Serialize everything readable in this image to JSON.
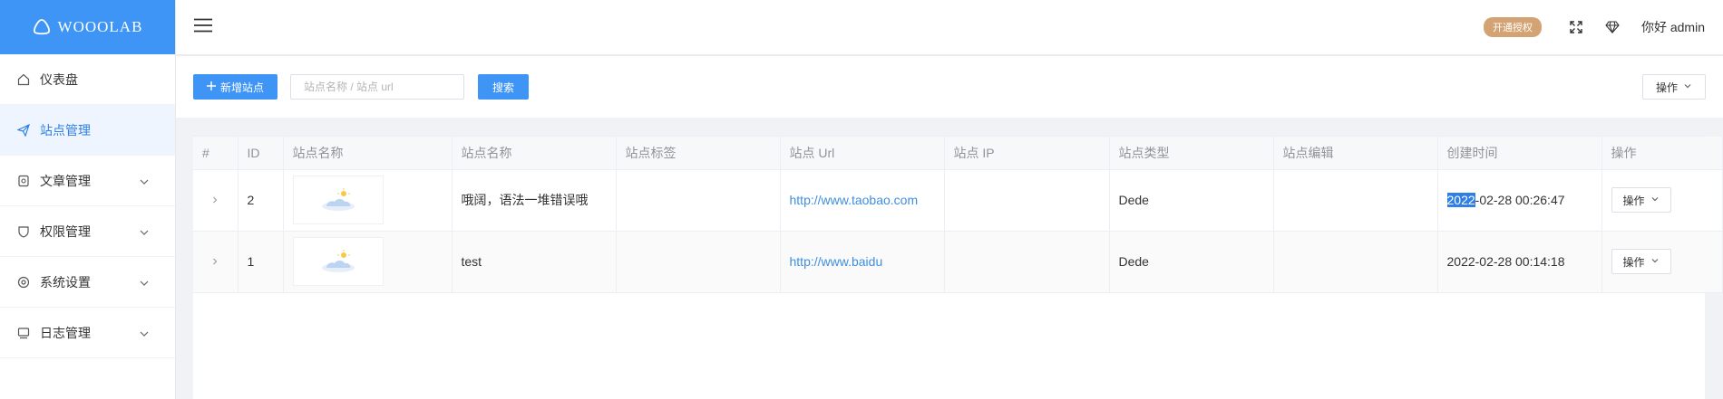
{
  "app": {
    "logo_text": "WOOOLAB"
  },
  "colors": {
    "primary": "#3f95f6",
    "badge": "#d4a373",
    "link": "#3f8fe0",
    "selection": "#2f7fe6"
  },
  "sidebar": {
    "items": [
      {
        "label": "仪表盘",
        "icon": "home-icon",
        "expandable": false
      },
      {
        "label": "站点管理",
        "icon": "send-icon",
        "expandable": false,
        "active": true
      },
      {
        "label": "文章管理",
        "icon": "article-icon",
        "expandable": true
      },
      {
        "label": "权限管理",
        "icon": "shield-icon",
        "expandable": true
      },
      {
        "label": "系统设置",
        "icon": "gear-icon",
        "expandable": true
      },
      {
        "label": "日志管理",
        "icon": "log-icon",
        "expandable": true
      }
    ]
  },
  "header": {
    "badge": "开通授权",
    "fullscreen_icon": "fullscreen-icon",
    "vip_icon": "diamond-icon",
    "user": "你好 admin"
  },
  "toolbar": {
    "add_label": "新增站点",
    "search_placeholder": "站点名称 / 站点 url",
    "search_value": "",
    "search_label": "搜索",
    "ops_label": "操作"
  },
  "table": {
    "columns": [
      "#",
      "ID",
      "站点名称",
      "站点名称",
      "站点标签",
      "站点 Url",
      "站点 IP",
      "站点类型",
      "站点编辑",
      "创建时间",
      "操作"
    ],
    "rows": [
      {
        "id": "2",
        "name": "哦阔，语法一堆错误哦",
        "tag": "",
        "url": "http://www.taobao.com",
        "ip": "",
        "type": "Dede",
        "edit": "",
        "created_sel": "2022",
        "created_rest": "-02-28 00:26:47",
        "action": "操作"
      },
      {
        "id": "1",
        "name": "test",
        "tag": "",
        "url": "http://www.baidu",
        "ip": "",
        "type": "Dede",
        "edit": "",
        "created_sel": "",
        "created_rest": "2022-02-28 00:14:18",
        "action": "操作"
      }
    ]
  }
}
